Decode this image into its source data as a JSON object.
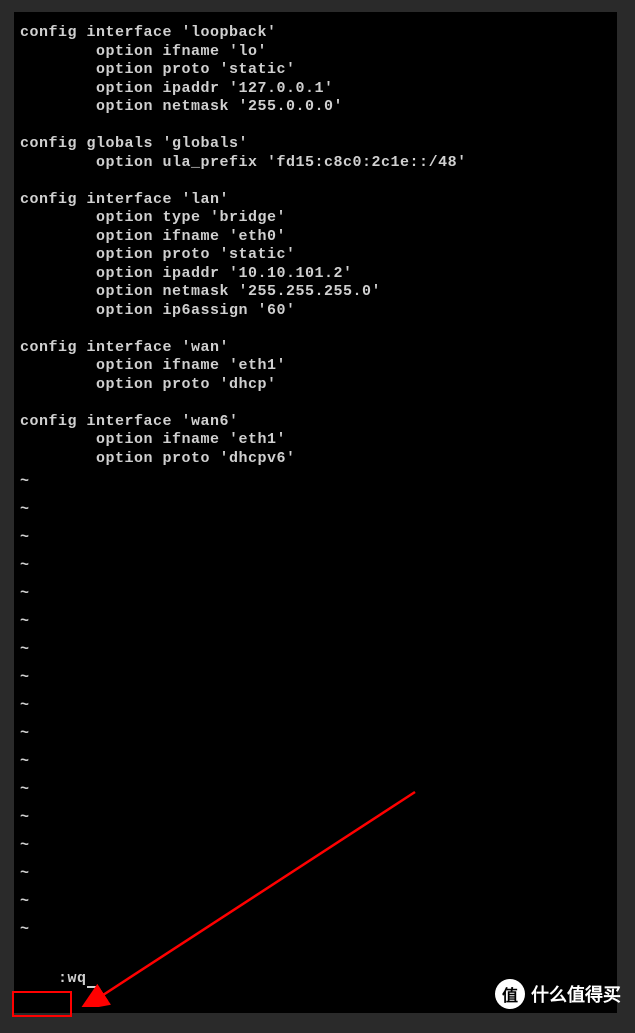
{
  "config": {
    "sections": [
      {
        "header": "config interface 'loopback'",
        "options": [
          "        option ifname 'lo'",
          "        option proto 'static'",
          "        option ipaddr '127.0.0.1'",
          "        option netmask '255.0.0.0'"
        ]
      },
      {
        "header": "config globals 'globals'",
        "options": [
          "        option ula_prefix 'fd15:c8c0:2c1e::/48'"
        ]
      },
      {
        "header": "config interface 'lan'",
        "options": [
          "        option type 'bridge'",
          "        option ifname 'eth0'",
          "        option proto 'static'",
          "        option ipaddr '10.10.101.2'",
          "        option netmask '255.255.255.0'",
          "        option ip6assign '60'"
        ]
      },
      {
        "header": "config interface 'wan'",
        "options": [
          "        option ifname 'eth1'",
          "        option proto 'dhcp'"
        ]
      },
      {
        "header": "config interface 'wan6'",
        "options": [
          "        option ifname 'eth1'",
          "        option proto 'dhcpv6'"
        ]
      }
    ]
  },
  "tilde": "~",
  "tilde_count": 17,
  "command": ":wq",
  "watermark": {
    "badge": "值",
    "text": "什么值得买"
  },
  "annotation": {
    "box_color": "#ff0000",
    "arrow_color": "#ff0000"
  }
}
